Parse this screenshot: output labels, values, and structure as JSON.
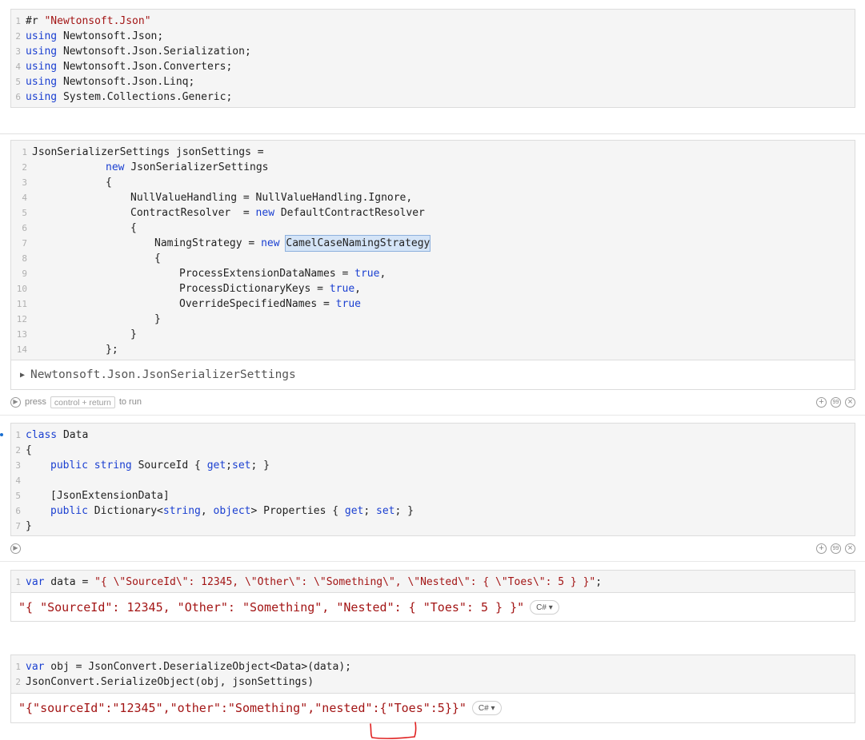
{
  "cell1": {
    "lines": [
      [
        "1",
        "#r ",
        "\"Newtonsoft.Json\""
      ],
      [
        "2",
        "using",
        " Newtonsoft.Json;"
      ],
      [
        "3",
        "using",
        " Newtonsoft.Json.Serialization;"
      ],
      [
        "4",
        "using",
        " Newtonsoft.Json.Converters;"
      ],
      [
        "5",
        "using",
        " Newtonsoft.Json.Linq;"
      ],
      [
        "6",
        "using",
        " System.Collections.Generic;"
      ]
    ]
  },
  "cell2": {
    "ln": [
      "1",
      "2",
      "3",
      "4",
      "5",
      "6",
      "7",
      "8",
      "9",
      "10",
      "11",
      "12",
      "13",
      "14"
    ],
    "l1": "JsonSerializerSettings jsonSettings =",
    "l2_kw": "new",
    "l2_rest": " JsonSerializerSettings",
    "l3": "{",
    "l4": "NullValueHandling = NullValueHandling.Ignore,",
    "l5_a": "ContractResolver  = ",
    "l5_kw": "new",
    "l5_b": " DefaultContractResolver",
    "l6": "{",
    "l7_a": "NamingStrategy = ",
    "l7_kw": "new",
    "l7_sel": "CamelCaseNamingStrategy",
    "l8": "{",
    "l9_a": "ProcessExtensionDataNames = ",
    "l9_kw": "true",
    "l9_b": ",",
    "l10_a": "ProcessDictionaryKeys = ",
    "l10_kw": "true",
    "l10_b": ",",
    "l11_a": "OverrideSpecifiedNames = ",
    "l11_kw": "true",
    "l12": "}",
    "l13": "}",
    "l14": "};",
    "output": "Newtonsoft.Json.JsonSerializerSettings",
    "press": "press",
    "shortcut": "control + return",
    "to_run": "to run"
  },
  "cell3": {
    "ln": [
      "1",
      "2",
      "3",
      "4",
      "5",
      "6",
      "7"
    ],
    "l1_kw": "class",
    "l1_rest": " Data",
    "l2": "{",
    "l3_kw1": "public",
    "l3_kw2": "string",
    "l3_a": " SourceId { ",
    "l3_kw3": "get",
    "l3_b": ";",
    "l3_kw4": "set",
    "l3_c": "; }",
    "l5": "[JsonExtensionData]",
    "l6_kw1": "public",
    "l6_a": " Dictionary<",
    "l6_kw2": "string",
    "l6_b": ", ",
    "l6_kw3": "object",
    "l6_c": "> Properties { ",
    "l6_kw4": "get",
    "l6_d": "; ",
    "l6_kw5": "set",
    "l6_e": "; }",
    "l7": "}"
  },
  "cell4": {
    "ln": "1",
    "kw": "var",
    "a": " data = ",
    "str": "\"{ \\\"SourceId\\\": 12345, \\\"Other\\\": \\\"Something\\\", \\\"Nested\\\": { \\\"Toes\\\": 5 } }\"",
    "b": ";",
    "output": "\"{ \"SourceId\": 12345, \"Other\": \"Something\", \"Nested\": { \"Toes\": 5 } }\"",
    "badge": "C# ▾"
  },
  "cell5": {
    "ln": [
      "1",
      "2"
    ],
    "l1_kw": "var",
    "l1_rest": " obj = JsonConvert.DeserializeObject<Data>(data);",
    "l2": "JsonConvert.SerializeObject(obj, jsonSettings)",
    "output": "\"{\"sourceId\":\"12345\",\"other\":\"Something\",\"nested\":{\"Toes\":5}}\"",
    "badge": "C# ▾"
  },
  "icons": {
    "run": "▶",
    "add": "+",
    "quote": "99",
    "close": "×",
    "expand": "▶"
  },
  "colors": {
    "keyword": "#1a3fd1",
    "string": "#a31515",
    "annotation": "#e02020",
    "cell_bg": "#f5f5f5"
  }
}
